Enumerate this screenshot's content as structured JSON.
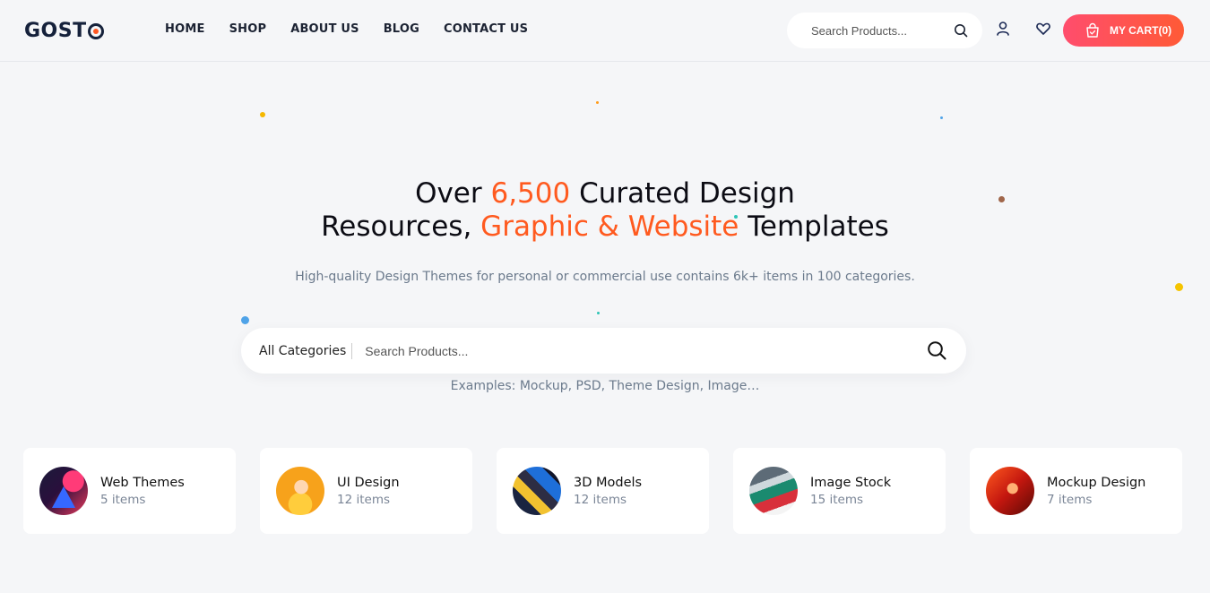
{
  "header": {
    "logo": "GOSTO",
    "logo_prefix": "GOST",
    "nav": [
      "HOME",
      "SHOP",
      "ABOUT US",
      "BLOG",
      "CONTACT US"
    ],
    "search_placeholder": "Search Products...",
    "cart_label": "MY CART(0)"
  },
  "hero": {
    "title_line1_a": "Over ",
    "title_line1_accent": "6,500",
    "title_line1_b": " Curated Design",
    "title_line2_a": "Resources, ",
    "title_line2_accent": "Graphic & Website",
    "title_line2_b": " Templates",
    "subtitle": "High-quality Design Themes for personal or commercial use contains 6k+ items in 100 categories.",
    "category_select": "All Categories",
    "search_placeholder": "Search Products...",
    "examples": "Examples: Mockup, PSD, Theme Design, Image…"
  },
  "categories": [
    {
      "name": "Web Themes",
      "count": "5 items"
    },
    {
      "name": "UI Design",
      "count": "12 items"
    },
    {
      "name": "3D Models",
      "count": "12 items"
    },
    {
      "name": "Image Stock",
      "count": "15 items"
    },
    {
      "name": "Mockup Design",
      "count": "7 items"
    }
  ],
  "colors": {
    "accent": "#ff5a1f",
    "cart_gradient_start": "#ff4d6d",
    "cart_gradient_end": "#ff5a36",
    "background": "#f5f6f8"
  },
  "icons": {
    "header_search": "search-icon",
    "user": "user-icon",
    "wishlist": "heart-icon",
    "cart": "shopping-bag-icon",
    "hero_search": "search-icon"
  }
}
